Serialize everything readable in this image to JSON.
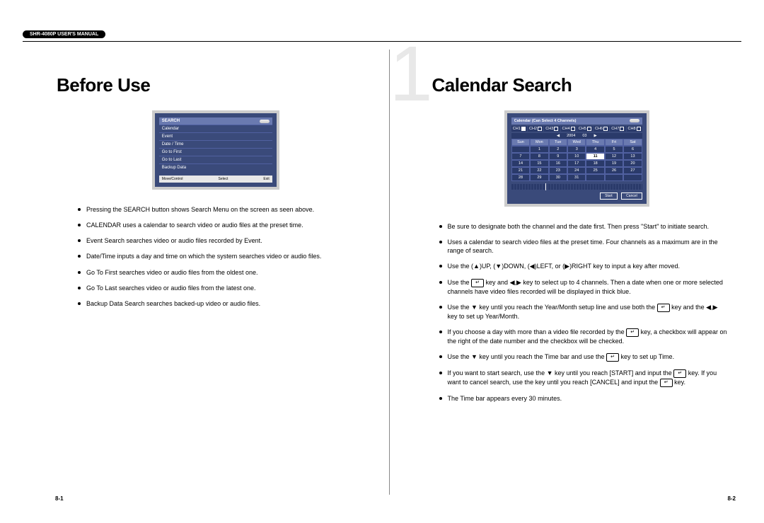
{
  "header": {
    "manual": "SHR-4080P USER'S MANUAL"
  },
  "left": {
    "heading": "Before Use",
    "fig": {
      "title": "SEARCH",
      "items": [
        "Calendar",
        "Event",
        "Date / Time",
        "Go to First",
        "Go to Last",
        "Backup Data"
      ],
      "footer": [
        "Move/Control",
        "Select",
        "Exit"
      ]
    },
    "bullets": [
      "Pressing the SEARCH button shows Search Menu on the screen as seen above.",
      "CALENDAR uses a calendar to search video or audio files at the preset time.",
      "Event Search searches video or audio files recorded by Event.",
      "Date/Time inputs a day and time on which the system searches video or audio files.",
      "Go To First searches video or audio files from the oldest one.",
      "Go To Last searches video or audio files from the latest one.",
      "Backup Data Search searches backed-up video or audio files."
    ],
    "pagenum": "8-1"
  },
  "right": {
    "chapter_number": "1",
    "heading": "Calendar Search",
    "fig": {
      "title": "Calendar (Can Select 4 Channels)",
      "channels": [
        "CH1",
        "CH2",
        "CH3",
        "CH4",
        "CH5",
        "CH6",
        "CH7",
        "CH8"
      ],
      "year": "2004",
      "month": "03",
      "days": [
        "Sun",
        "Mon",
        "Tue",
        "Wed",
        "Thu",
        "Fri",
        "Sat"
      ],
      "weeks": [
        [
          "",
          "1",
          "2",
          "3",
          "4",
          "5",
          "6"
        ],
        [
          "7",
          "8",
          "9",
          "10",
          "11",
          "12",
          "13"
        ],
        [
          "14",
          "15",
          "16",
          "17",
          "18",
          "19",
          "20"
        ],
        [
          "21",
          "22",
          "23",
          "24",
          "25",
          "26",
          "27"
        ],
        [
          "28",
          "29",
          "30",
          "31",
          "",
          "",
          ""
        ]
      ],
      "selected_day": "11",
      "btn_start": "Start",
      "btn_cancel": "Cancel"
    },
    "bullets": {
      "b1": "Be sure to designate both the channel and the date first. Then press \"Start\" to initiate search.",
      "b2": "Uses a calendar to search video files at the preset time. Four channels as a maximum are in the range of search.",
      "b3_a": "Use the (",
      "b3_up": "▲",
      "b3_b": ")UP, (",
      "b3_dn": "▼",
      "b3_c": ")DOWN, (",
      "b3_lf": "◀",
      "b3_d": ")LEFT, or (",
      "b3_rt": "▶",
      "b3_e": ")RIGHT key to input a key after moved.",
      "b4_a": "Use the ",
      "b4_b": " key and ",
      "b4_lr": "◀,▶",
      "b4_c": " key to select up to 4 channels. Then a date when one or more selected channels have video files recorded will be displayed in thick blue.",
      "b5_a": "Use the ▼ key until you reach the Year/Month setup line and use both the ",
      "b5_b": " key and the ",
      "b5_lr": "◀,▶",
      "b5_c": " key to set up Year/Month.",
      "b6_a": "If you choose a day with more than a video file recorded by the ",
      "b6_b": " key, a checkbox will appear on the right of the date number and the checkbox will be checked.",
      "b7_a": "Use the ▼ key until you reach the Time bar and use the ",
      "b7_b": " key to set up Time.",
      "b8_a": "If you want to start search, use the ▼ key until you reach [START] and input the ",
      "b8_b": " key. If you want to cancel search, use the  key until you reach [CANCEL] and input the ",
      "b8_c": " key.",
      "b9": "The Time bar appears every 30 minutes."
    },
    "pagenum": "8-2"
  }
}
